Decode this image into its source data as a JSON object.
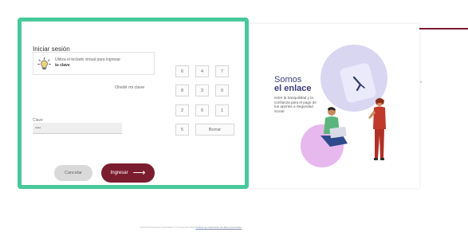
{
  "login": {
    "title": "Iniciar sesión",
    "hint_text": "Utiliza el teclado virtual para ingresar",
    "hint_bold": "tu clave",
    "forgot_link": "Olvidé mi clave",
    "password_label": "Clave",
    "password_value": "••••",
    "keypad": {
      "keys": [
        "6",
        "4",
        "7",
        "8",
        "3",
        "0",
        "2",
        "9",
        "1",
        "5"
      ],
      "erase_label": "Borrar"
    },
    "cancel_label": "Cancelar",
    "login_label": "Ingresar",
    "login_arrow": "⟶"
  },
  "promo": {
    "title_line1": "Somos",
    "title_line2": "el enlace",
    "body": "entre la tranquilidad y la confianza para el pago de tus aportes a Seguridad Social"
  },
  "footer": {
    "text": "Todos los derechos reservados © Compensar 2024",
    "link": "Política de tratamiento de datos personales"
  },
  "colors": {
    "highlight_border": "#48c99b",
    "brand_maroon": "#7a1d2e",
    "promo_title": "#3c3c78",
    "blob_lavender": "#d9d6f2",
    "blob_pink": "#e7b8ee"
  },
  "icons": {
    "hint": "lightbulb-icon",
    "login_arrow": "arrow-right-icon",
    "promo_logo": "brand-logo-icon"
  }
}
